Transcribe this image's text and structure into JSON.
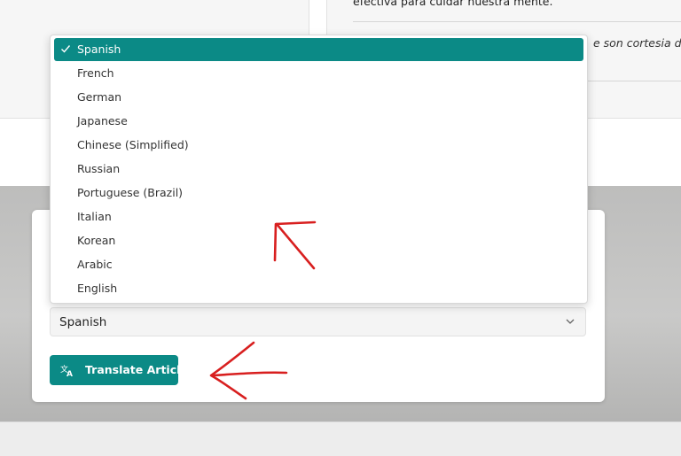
{
  "article": {
    "paragraph_fragment": "efectiva para cuidar nuestra mente.",
    "caption_fragment": "e son cortesia de P"
  },
  "language_dropdown": {
    "options": [
      "Spanish",
      "French",
      "German",
      "Japanese",
      "Chinese (Simplified)",
      "Russian",
      "Portuguese (Brazil)",
      "Italian",
      "Korean",
      "Arabic",
      "English"
    ],
    "selected_index": 0
  },
  "language_select": {
    "value": "Spanish"
  },
  "translate_button": {
    "label": "Translate Article"
  },
  "colors": {
    "accent": "#0b8a86",
    "annotation": "#d81f1f"
  },
  "icons": {
    "check": "check-icon",
    "chevron": "chevron-down-icon",
    "translate": "translate-icon"
  }
}
